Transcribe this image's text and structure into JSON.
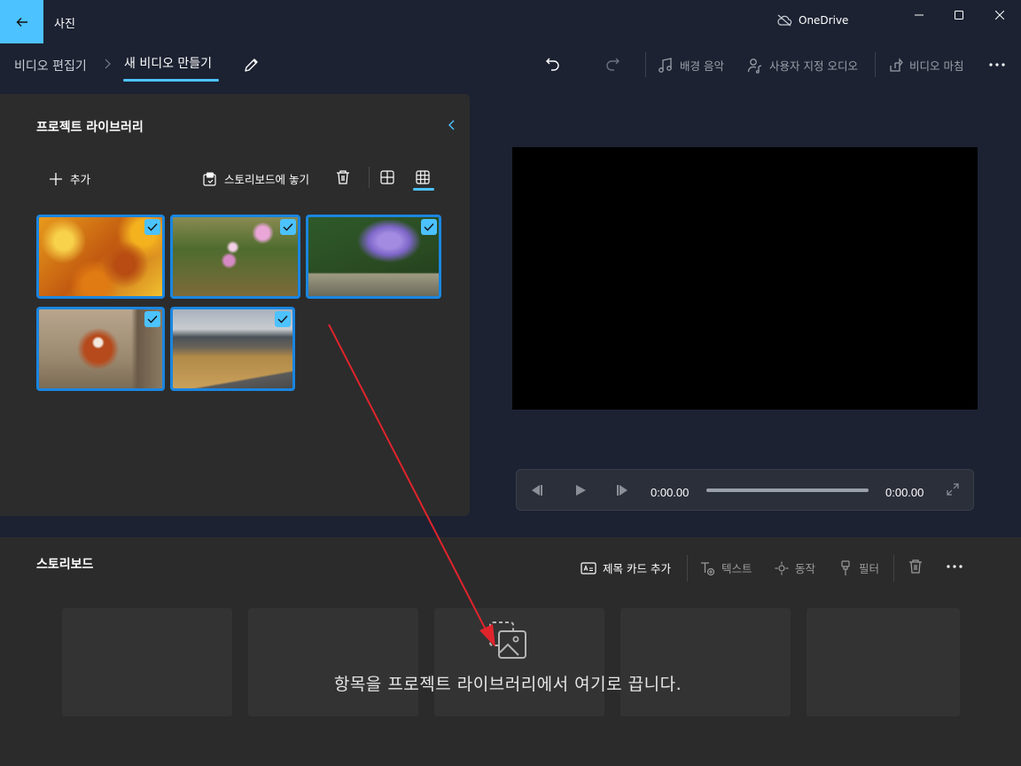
{
  "window": {
    "title": "사진",
    "cloud_status": "OneDrive"
  },
  "breadcrumb": {
    "parent": "비디오 편집기",
    "current": "새 비디오 만들기"
  },
  "toolbar": {
    "background_music": "배경 음악",
    "custom_audio": "사용자 지정 오디오",
    "finish_video": "비디오 마침"
  },
  "library": {
    "title": "프로젝트 라이브러리",
    "add_label": "추가",
    "place_in_storyboard": "스토리보드에 놓기",
    "items": [
      {
        "subject": "autumn leaves",
        "selected": true
      },
      {
        "subject": "wildflowers with butterfly",
        "selected": true
      },
      {
        "subject": "purple water hyacinth",
        "selected": true
      },
      {
        "subject": "red panda",
        "selected": true
      },
      {
        "subject": "mountain road landscape",
        "selected": true
      }
    ]
  },
  "player": {
    "current_time": "0:00.00",
    "total_time": "0:00.00",
    "progress": 0
  },
  "storyboard": {
    "title": "스토리보드",
    "add_title_card": "제목 카드 추가",
    "text": "텍스트",
    "motion": "동작",
    "filters": "필터",
    "empty_message": "항목을 프로젝트 라이브러리에서 여기로 끕니다.",
    "slot_count": 5
  },
  "colors": {
    "accent": "#4cc2ff",
    "selection_border": "#1a86e0",
    "annotation_arrow": "#e0242c"
  },
  "icons": [
    "back-arrow-icon",
    "cloud-off-icon",
    "undo-icon",
    "redo-icon",
    "music-note-icon",
    "person-audio-icon",
    "share-export-icon",
    "more-icon",
    "plus-icon",
    "storyboard-place-icon",
    "trash-icon",
    "grid-large-icon",
    "grid-small-icon",
    "check-icon",
    "skip-back-icon",
    "play-icon",
    "skip-forward-icon",
    "fullscreen-icon",
    "title-card-icon",
    "text-icon",
    "motion-icon",
    "filter-icon",
    "image-stack-icon"
  ]
}
